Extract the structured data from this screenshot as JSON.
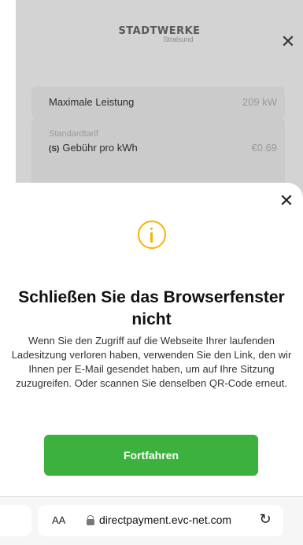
{
  "background": {
    "brand": {
      "name": "STADTWERKE",
      "sub": "Stralsund"
    },
    "cards": [
      {
        "label": "Maximale Leistung",
        "value": "209 kW"
      },
      {
        "group": "Standardtarif",
        "icon_text": "(S)",
        "label": "Gebühr pro kWh",
        "value": "€0.69"
      }
    ]
  },
  "modal": {
    "title": "Schließen Sie das Browserfenster nicht",
    "body": "Wenn Sie den Zugriff auf die Webseite Ihrer laufenden Ladesitzung verloren haben, verwenden Sie den Link, den wir Ihnen per E-Mail gesendet haben, um auf Ihre Sitzung zuzugreifen. Oder scannen Sie denselben QR-Code erneut.",
    "button_label": "Fortfahren",
    "icons": {
      "info": "info-icon",
      "close": "close-icon"
    },
    "colors": {
      "accent": "#f4b400",
      "button": "#3db13d"
    }
  },
  "browser": {
    "text_size_label": "AA",
    "url": "directpayment.evc-net.com",
    "reload_glyph": "↻"
  }
}
